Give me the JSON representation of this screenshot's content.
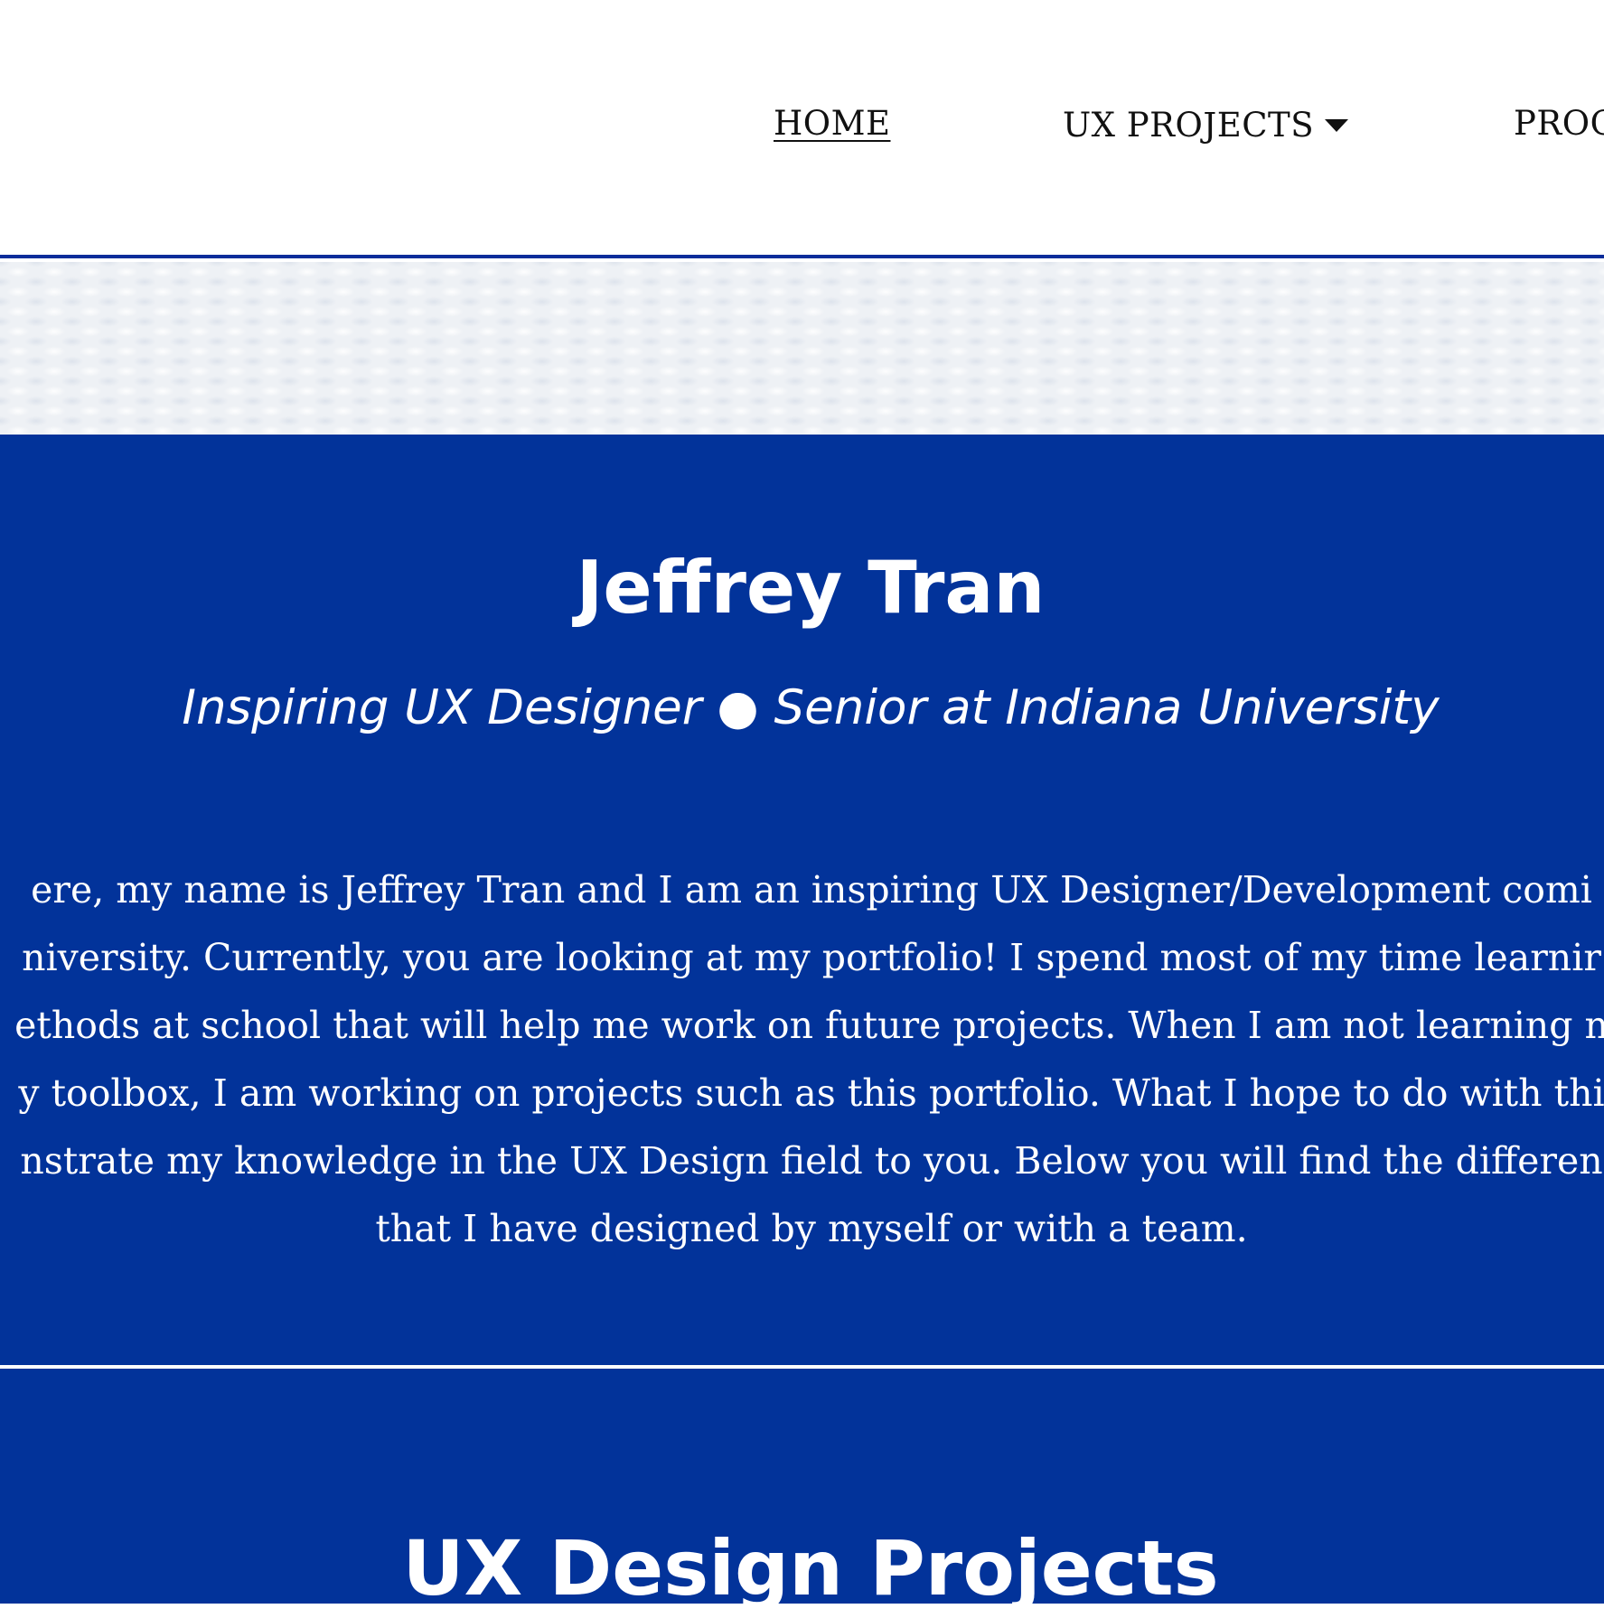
{
  "nav": {
    "home_label": "HOME",
    "ux_projects_label": "UX PROJECTS",
    "programming_label": "PROG"
  },
  "hero": {
    "name": "Jeffrey Tran",
    "tagline": "Inspiring UX Designer ● Senior at Indiana University",
    "bio_lines": [
      "ere, my name is Jeffrey Tran and I am an inspiring UX Designer/Development comi",
      "niversity. Currently, you are looking at my portfolio! I spend most of my time learnir",
      "ethods at school that will help me work on future projects. When I am not learning n",
      "y toolbox, I am working on projects such as this portfolio. What I hope to do with thi",
      "nstrate my knowledge in the UX Design field to you. Below you will find the differen",
      "that I have designed by myself or with a team."
    ]
  },
  "projects": {
    "heading": "UX Design Projects"
  },
  "colors": {
    "primary_blue": "#02339a",
    "nav_border": "#0a2c9a",
    "texture_band": "#eef1f5",
    "text_on_blue": "#ffffff",
    "nav_text": "#111111"
  },
  "icons": {
    "dropdown": "caret-down-icon"
  }
}
